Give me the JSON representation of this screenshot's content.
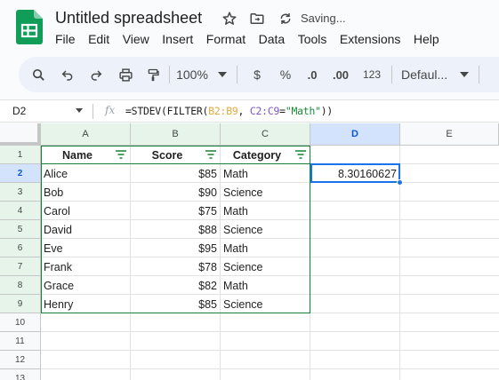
{
  "app": {
    "title": "Untitled spreadsheet",
    "status": "Saving...",
    "colors": {
      "brand": "#0f9d58",
      "accent": "#1a73e8",
      "table_border": "#188038"
    }
  },
  "menu": [
    "File",
    "Edit",
    "View",
    "Insert",
    "Format",
    "Data",
    "Tools",
    "Extensions",
    "Help"
  ],
  "toolbar": {
    "icons": [
      "search-icon",
      "undo-icon",
      "redo-icon",
      "print-icon",
      "paint-format-icon"
    ],
    "zoom": "100%",
    "currency": "$",
    "percent": "%",
    "decrease_decimal": ".0",
    "increase_decimal": ".00",
    "number_format": "123",
    "font": "Defaul..."
  },
  "formula_bar": {
    "name_box": "D2",
    "fx": "fx",
    "formula_parts": [
      "=STDEV(FILTER(",
      "B2:B9",
      ", ",
      "C2:C9",
      "=",
      "\"Math\"",
      "))"
    ]
  },
  "sheet": {
    "columns": [
      "A",
      "B",
      "C",
      "D",
      "E"
    ],
    "rows": [
      "1",
      "2",
      "3",
      "4",
      "5",
      "6",
      "7",
      "8",
      "9",
      "10",
      "11",
      "12",
      "13"
    ],
    "selected_cell": "D2",
    "table_headers": [
      "Name",
      "Score",
      "Category"
    ],
    "table_rows": [
      [
        "Alice",
        "$85",
        "Math"
      ],
      [
        "Bob",
        "$90",
        "Science"
      ],
      [
        "Carol",
        "$75",
        "Math"
      ],
      [
        "David",
        "$88",
        "Science"
      ],
      [
        "Eve",
        "$95",
        "Math"
      ],
      [
        "Frank",
        "$78",
        "Science"
      ],
      [
        "Grace",
        "$82",
        "Math"
      ],
      [
        "Henry",
        "$85",
        "Science"
      ]
    ],
    "d2_value": "8.30160627"
  }
}
